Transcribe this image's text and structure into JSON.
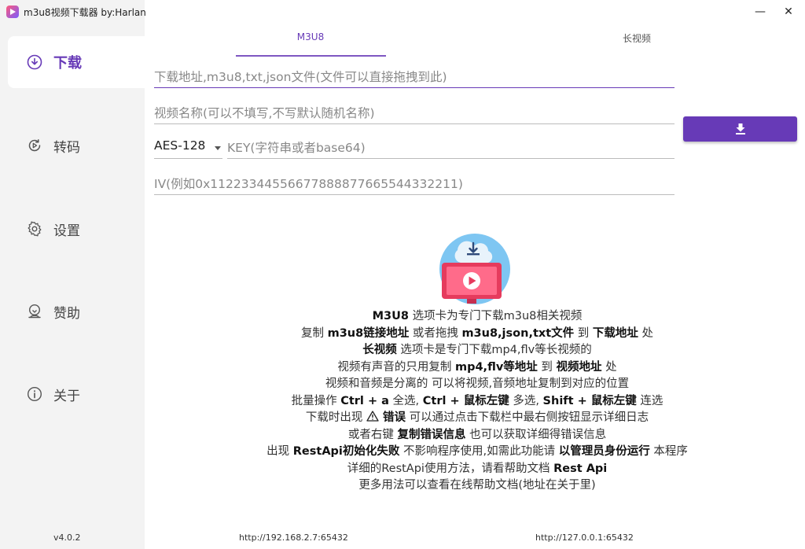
{
  "window": {
    "title": "m3u8视频下载器 by:Harlan",
    "minimize_glyph": "—",
    "close_glyph": "✕"
  },
  "sidebar": {
    "items": [
      {
        "label": "下载",
        "icon": "download-circle-icon",
        "active": true
      },
      {
        "label": "转码",
        "icon": "transcode-icon",
        "active": false
      },
      {
        "label": "设置",
        "icon": "gear-icon",
        "active": false
      },
      {
        "label": "赞助",
        "icon": "sponsor-icon",
        "active": false
      },
      {
        "label": "关于",
        "icon": "info-icon",
        "active": false
      }
    ],
    "version": "v4.0.2"
  },
  "tabs": [
    {
      "label": "M3U8",
      "active": true
    },
    {
      "label": "长视频",
      "active": false
    }
  ],
  "form": {
    "url_placeholder": "下载地址,m3u8,txt,json文件(文件可以直接拖拽到此)",
    "name_placeholder": "视频名称(可以不填写,不写默认随机名称)",
    "method_selected": "AES-128",
    "key_placeholder": "KEY(字符串或者base64)",
    "iv_placeholder": "IV(例如0x11223344556677888877665544332211)"
  },
  "help": {
    "l1": {
      "a": "M3U8",
      "b": " 选项卡为专门下载m3u8相关视频"
    },
    "l2": {
      "a": "复制 ",
      "b": "m3u8链接地址",
      "c": " 或者拖拽 ",
      "d": "m3u8,json,txt文件",
      "e": " 到 ",
      "f": "下载地址",
      "g": " 处"
    },
    "l3": {
      "a": "长视频",
      "b": " 选项卡是专门下载mp4,flv等长视频的"
    },
    "l4": {
      "a": "视频有声音的只用复制 ",
      "b": "mp4,flv等地址",
      "c": " 到 ",
      "d": "视频地址",
      "e": " 处"
    },
    "l5": {
      "a": "视频和音频是分离的 可以将视频,音频地址复制到对应的位置"
    },
    "l6": {
      "a": "批量操作 ",
      "b": "Ctrl + a",
      "c": " 全选, ",
      "d": "Ctrl + 鼠标左键",
      "e": " 多选, ",
      "f": "Shift + 鼠标左键",
      "g": " 连选"
    },
    "l7": {
      "a": "下载时出现 ",
      "b": "错误",
      "c": " 可以通过点击下载栏中最右侧按钮显示详细日志"
    },
    "l8": {
      "a": "或者右键 ",
      "b": "复制错误信息",
      "c": " 也可以获取详细得错误信息"
    },
    "l9": {
      "a": "出现 ",
      "b": "RestApi初始化失败",
      "c": " 不影响程序使用,如需此功能请 ",
      "d": "以管理员身份运行",
      "e": " 本程序"
    },
    "l10": {
      "a": "详细的RestApi使用方法，请看帮助文档 ",
      "b": "Rest Api"
    },
    "l11": {
      "a": "更多用法可以查看在线帮助文档(地址在关于里)"
    }
  },
  "footer": {
    "lan_address": "http://192.168.2.7:65432",
    "local_address": "http://127.0.0.1:65432"
  },
  "colors": {
    "accent": "#673ab7",
    "sidebar_bg": "#f3f3f3"
  }
}
